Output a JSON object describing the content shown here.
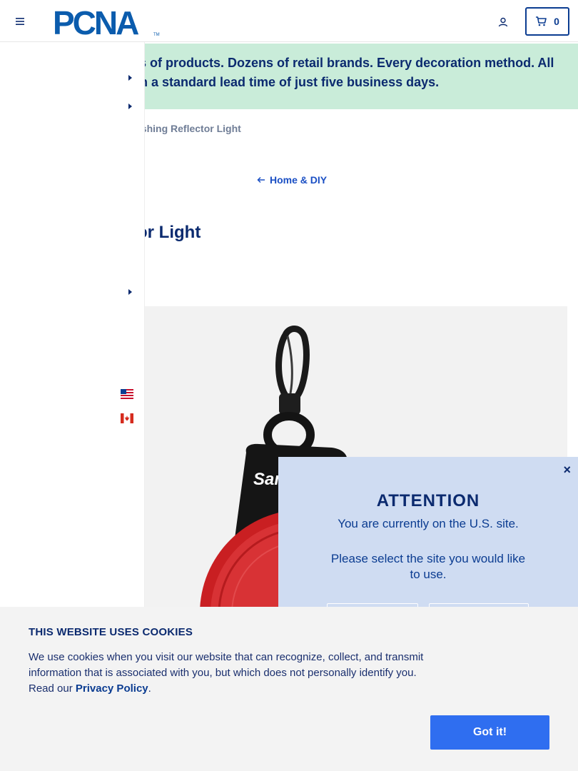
{
  "header": {
    "logo_text": "PCNA",
    "cart_count": "0"
  },
  "banner": {
    "line1": "ls of products. Dozens of retail brands. Every decoration method. All",
    "line2": "th a standard lead time of just five business days."
  },
  "breadcrumb": {
    "current": "ashing Reflector Light"
  },
  "back_link": {
    "label": "Home & DIY"
  },
  "product": {
    "title": "or Light",
    "image_imprint": "Sam"
  },
  "modal": {
    "close": "×",
    "title": "ATTENTION",
    "message": "You are currently on the U.S. site.",
    "prompt": "Please select the site you would like to use."
  },
  "cookie": {
    "title": "THIS WEBSITE USES COOKIES",
    "text": "We use cookies when you visit our website that can recognize, collect, and transmit information that is associated with you, but which does not personally identify you. Read our",
    "link": "Privacy Policy",
    "period": ".",
    "button": "Got it!"
  },
  "colors": {
    "brand_blue": "#0b3c91",
    "banner_green": "#c9ecd9",
    "modal_bg": "#cfdcf2",
    "cookie_button": "#2f6ef0",
    "product_red": "#d42a2a"
  },
  "icons": {
    "menu": "hamburger-icon",
    "account": "user-icon",
    "cart": "cart-icon",
    "back": "arrow-left-icon",
    "arrow": "caret-right-icon",
    "flag_us": "us-flag-icon",
    "flag_ca": "canada-flag-icon"
  }
}
